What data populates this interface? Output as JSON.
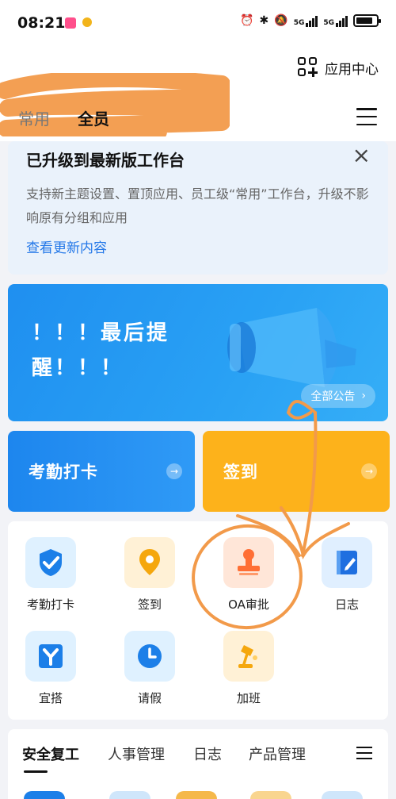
{
  "status_bar": {
    "time": "08:21",
    "network": "5G",
    "battery_level": 0.85
  },
  "header": {
    "app_center_label": "应用中心",
    "tabs": [
      {
        "label": "常用",
        "active": false
      },
      {
        "label": "全员",
        "active": true
      }
    ]
  },
  "notice": {
    "title": "已升级到最新版工作台",
    "description": "支持新主题设置、置顶应用、员工级“常用”工作台，升级不影响原有分组和应用",
    "link": "查看更新内容"
  },
  "banner": {
    "text": "！！！最后提醒！！！",
    "button_label": "全部公告"
  },
  "quick_cards": [
    {
      "label": "考勤打卡",
      "color": "#1d86ee"
    },
    {
      "label": "签到",
      "color": "#fdb21b"
    }
  ],
  "apps": [
    {
      "label": "考勤打卡",
      "icon": "check-shield-icon",
      "bg": "#dff1ff",
      "fg": "#1c7fe8"
    },
    {
      "label": "签到",
      "icon": "location-pin-icon",
      "bg": "#fff1d6",
      "fg": "#f5a70d"
    },
    {
      "label": "OA审批",
      "icon": "stamp-icon",
      "bg": "#ffe6d8",
      "fg": "#ff6f35"
    },
    {
      "label": "日志",
      "icon": "notebook-icon",
      "bg": "#e0efff",
      "fg": "#1f6fe0"
    },
    {
      "label": "宜搭",
      "icon": "yida-icon",
      "bg": "#dff1ff",
      "fg": "#1c7fe8"
    },
    {
      "label": "请假",
      "icon": "clock-icon",
      "bg": "#dff1ff",
      "fg": "#1c7fe8"
    },
    {
      "label": "加班",
      "icon": "desk-lamp-icon",
      "bg": "#fff1d6",
      "fg": "#f5a70d"
    }
  ],
  "bottom_tabs": [
    {
      "label": "安全复工",
      "active": true
    },
    {
      "label": "人事管理",
      "active": false
    },
    {
      "label": "日志",
      "active": false
    },
    {
      "label": "产品管理",
      "active": false
    }
  ],
  "colors": {
    "accent": "#2478e8",
    "annotation": "#f29a4a"
  }
}
